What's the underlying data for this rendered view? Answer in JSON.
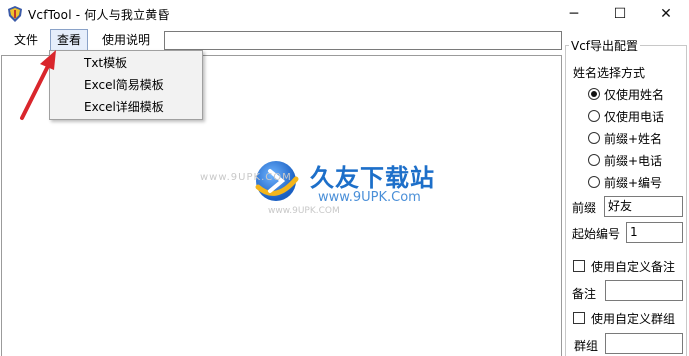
{
  "window": {
    "title": "VcfTool - 何人与我立黄昏",
    "icon": "app-shield-icon",
    "controls": {
      "minimize": "─",
      "maximize": "☐",
      "close": "✕"
    }
  },
  "menu": {
    "file": "文件",
    "view": "查看",
    "help": "使用说明",
    "field_value": ""
  },
  "dropdown": {
    "items": [
      "Txt模板",
      "Excel简易模板",
      "Excel详细模板"
    ]
  },
  "watermark": {
    "title": "久友下载站",
    "url": "www.9UPK.Com",
    "url_left": "www.9UPK.COM",
    "small": "www.9UPK.COM"
  },
  "panel": {
    "title": "Vcf导出配置",
    "name_mode_label": "姓名选择方式",
    "options": [
      {
        "label": "仅使用姓名",
        "selected": true
      },
      {
        "label": "仅使用电话",
        "selected": false
      },
      {
        "label": "前缀+姓名",
        "selected": false
      },
      {
        "label": "前缀+电话",
        "selected": false
      },
      {
        "label": "前缀+编号",
        "selected": false
      }
    ],
    "prefix_label": "前缀",
    "prefix_value": "好友",
    "start_label": "起始编号",
    "start_value": "1",
    "custom_note_label": "使用自定义备注",
    "note_label": "备注",
    "note_value": "",
    "custom_group_label": "使用自定义群组",
    "group_label": "群组",
    "group_value": ""
  },
  "colors": {
    "arrow": "#d9262c",
    "watermark_blue": "#1d6fc9",
    "menu_highlight": "#e6eefb"
  }
}
